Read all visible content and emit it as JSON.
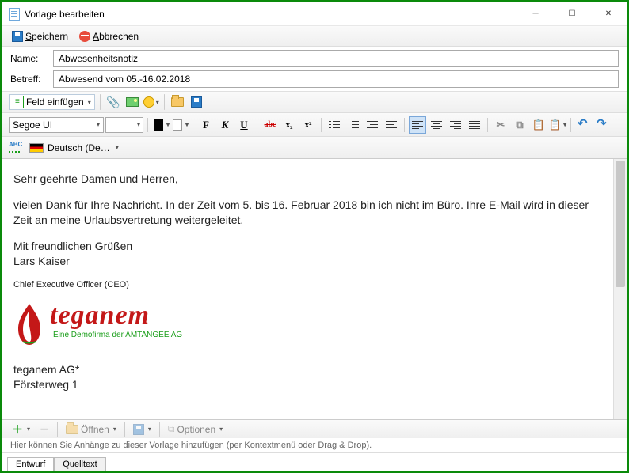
{
  "window": {
    "title": "Vorlage bearbeiten"
  },
  "toolbar_top": {
    "save": "Speichern",
    "cancel": "Abbrechen"
  },
  "form": {
    "name_label": "Name:",
    "name_value": "Abwesenheitsnotiz",
    "subject_label": "Betreff:",
    "subject_value": "Abwesend vom 05.-16.02.2018"
  },
  "insert_toolbar": {
    "insert_field": "Feld einfügen"
  },
  "format_toolbar": {
    "font": "Segoe UI",
    "size": "",
    "bold": "F",
    "italic": "K",
    "underline": "U",
    "strike": "abc",
    "sub": "x₂",
    "sup": "x²"
  },
  "lang_toolbar": {
    "language": "Deutsch (De…"
  },
  "body": {
    "greeting": "Sehr geehrte Damen und Herren,",
    "para1": "vielen Dank für Ihre Nachricht. In der Zeit vom 5. bis 16. Februar 2018 bin ich nicht im Büro. Ihre E-Mail wird in dieser Zeit an meine Urlaubsvertretung weitergeleitet.",
    "closing": "Mit freundlichen Grüßen",
    "name": "Lars Kaiser",
    "role": "Chief Executive Officer (CEO)",
    "logo_text": "teganem",
    "logo_sub": "Eine Demofirma der AMTANGEE AG",
    "company": "teganem AG*",
    "addr1": "Försterweg 1"
  },
  "attach_toolbar": {
    "open": "Öffnen",
    "options": "Optionen"
  },
  "hint": "Hier können Sie Anhänge zu dieser Vorlage hinzufügen (per Kontextmenü oder Drag & Drop).",
  "tabs": {
    "design": "Entwurf",
    "source": "Quelltext"
  }
}
